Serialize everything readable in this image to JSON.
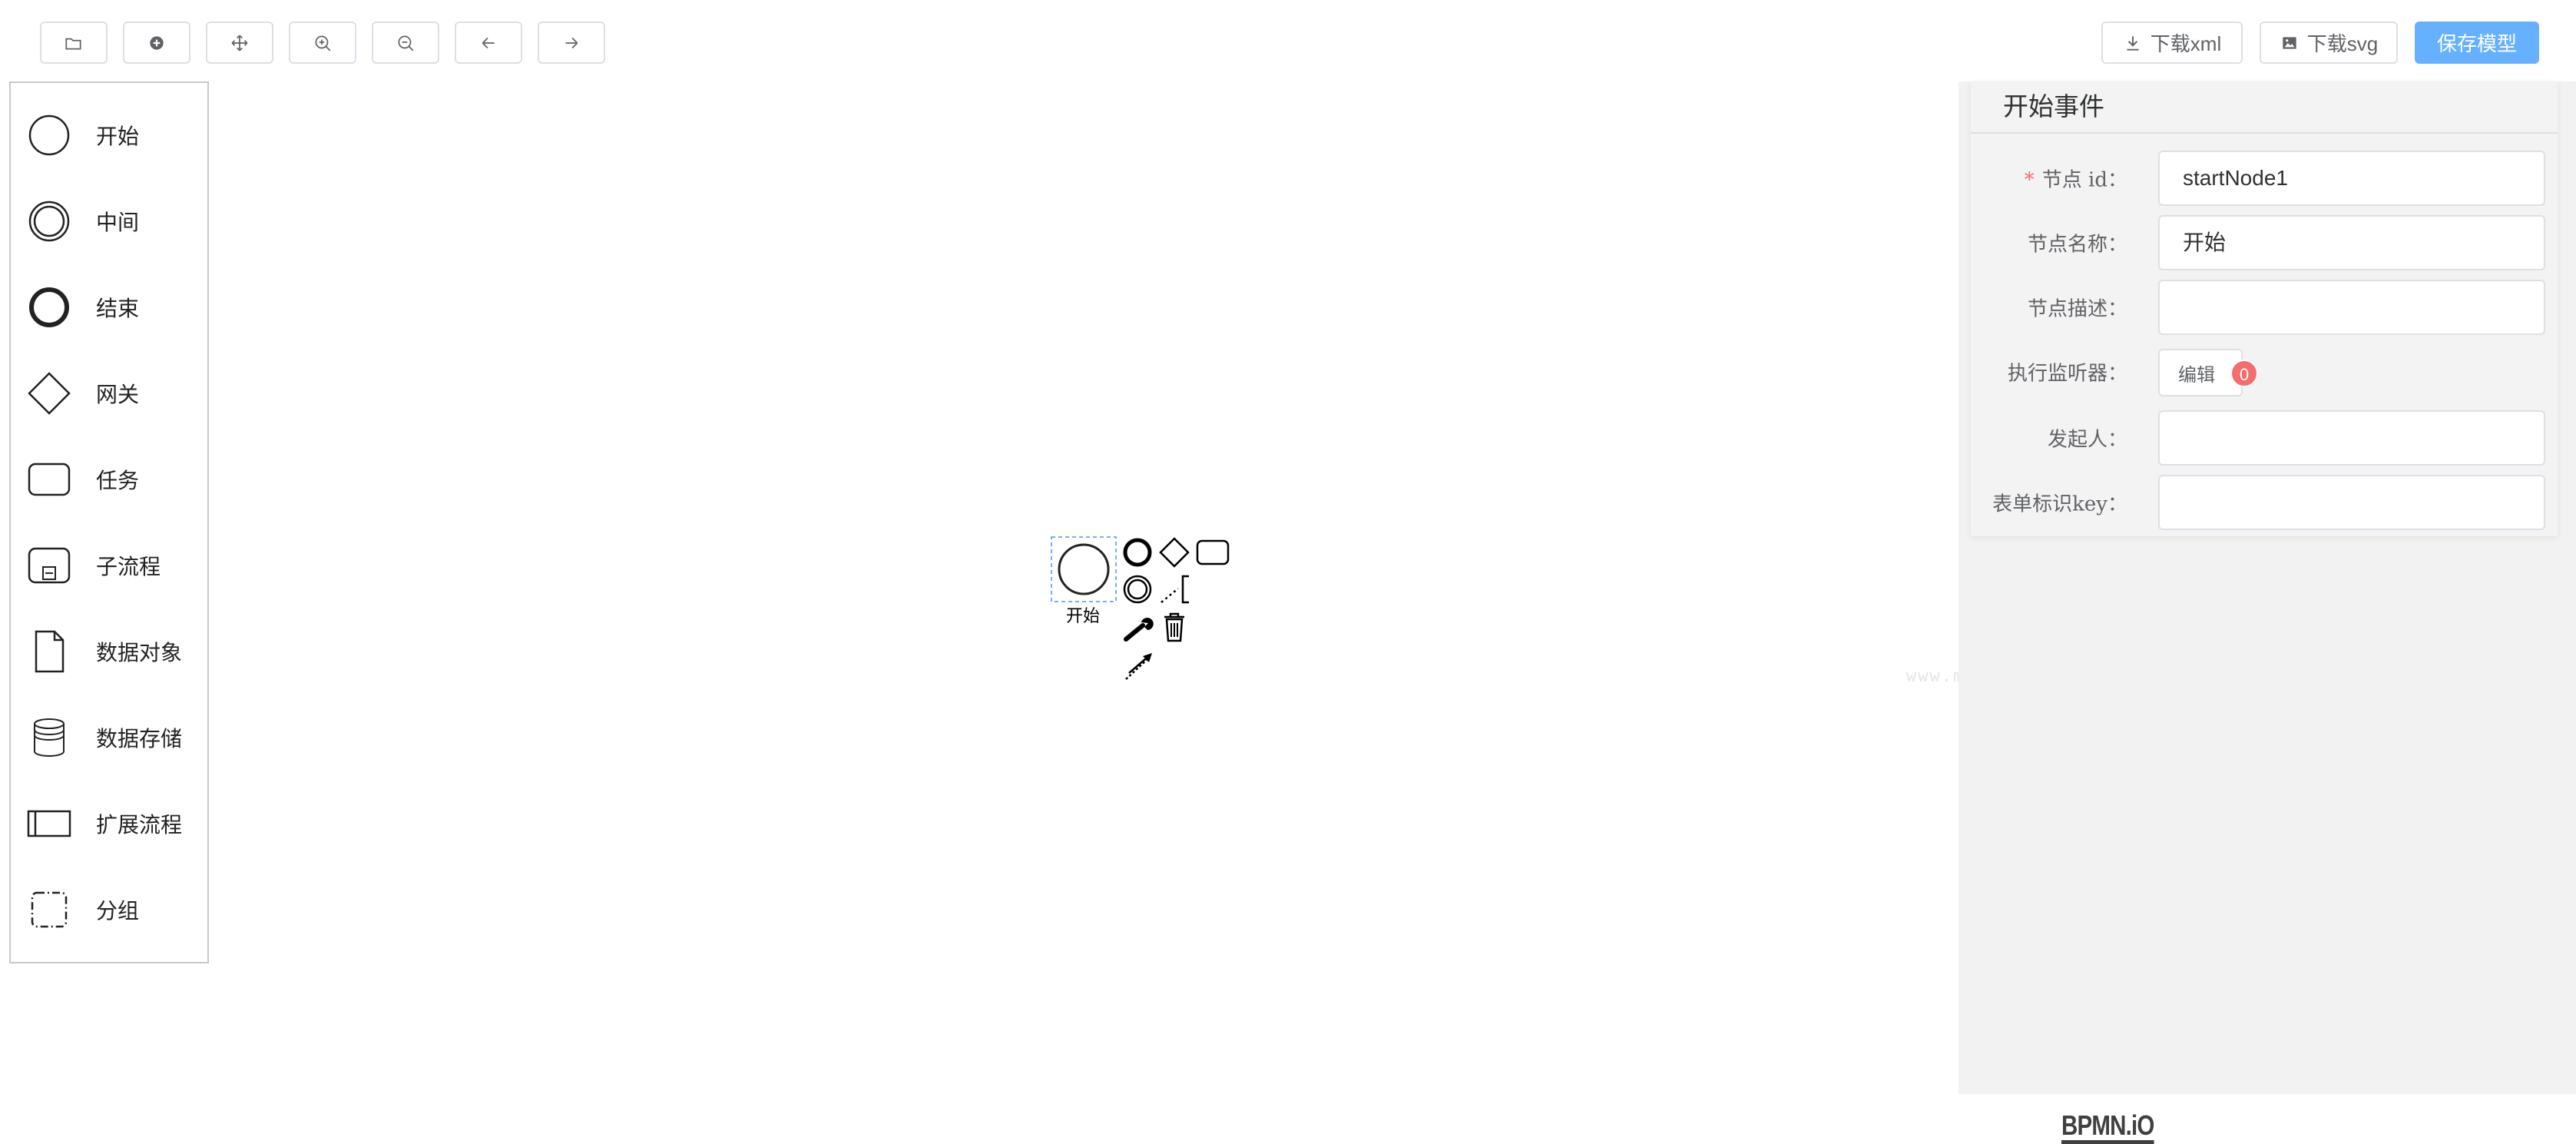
{
  "toolbar": {
    "download_xml_label": "下载xml",
    "download_svg_label": "下载svg",
    "save_label": "保存模型"
  },
  "palette": {
    "items": [
      {
        "label": "开始",
        "icon": "start-event-icon"
      },
      {
        "label": "中间",
        "icon": "intermediate-event-icon"
      },
      {
        "label": "结束",
        "icon": "end-event-icon"
      },
      {
        "label": "网关",
        "icon": "gateway-icon"
      },
      {
        "label": "任务",
        "icon": "task-icon"
      },
      {
        "label": "子流程",
        "icon": "subprocess-icon"
      },
      {
        "label": "数据对象",
        "icon": "data-object-icon"
      },
      {
        "label": "数据存储",
        "icon": "data-store-icon"
      },
      {
        "label": "扩展流程",
        "icon": "participant-icon"
      },
      {
        "label": "分组",
        "icon": "group-icon"
      }
    ]
  },
  "canvas": {
    "selected_node_label": "开始",
    "watermark": "www.mimiwuqi.com",
    "logo": "BPMN.iO"
  },
  "panel": {
    "title": "开始事件",
    "fields": [
      {
        "label": "节点 id：",
        "value": "startNode1",
        "required": true
      },
      {
        "label": "节点名称：",
        "value": "开始"
      },
      {
        "label": "节点描述：",
        "value": ""
      },
      {
        "label": "执行监听器：",
        "button": "编辑",
        "count": "0"
      },
      {
        "label": "发起人：",
        "value": ""
      },
      {
        "label": "表单标识key：",
        "value": ""
      }
    ]
  },
  "colors": {
    "primary_button": "#66b1ff",
    "badge": "#f56c6c",
    "required_star": "#f56c6c",
    "panel_bg": "#f2f2f2"
  }
}
